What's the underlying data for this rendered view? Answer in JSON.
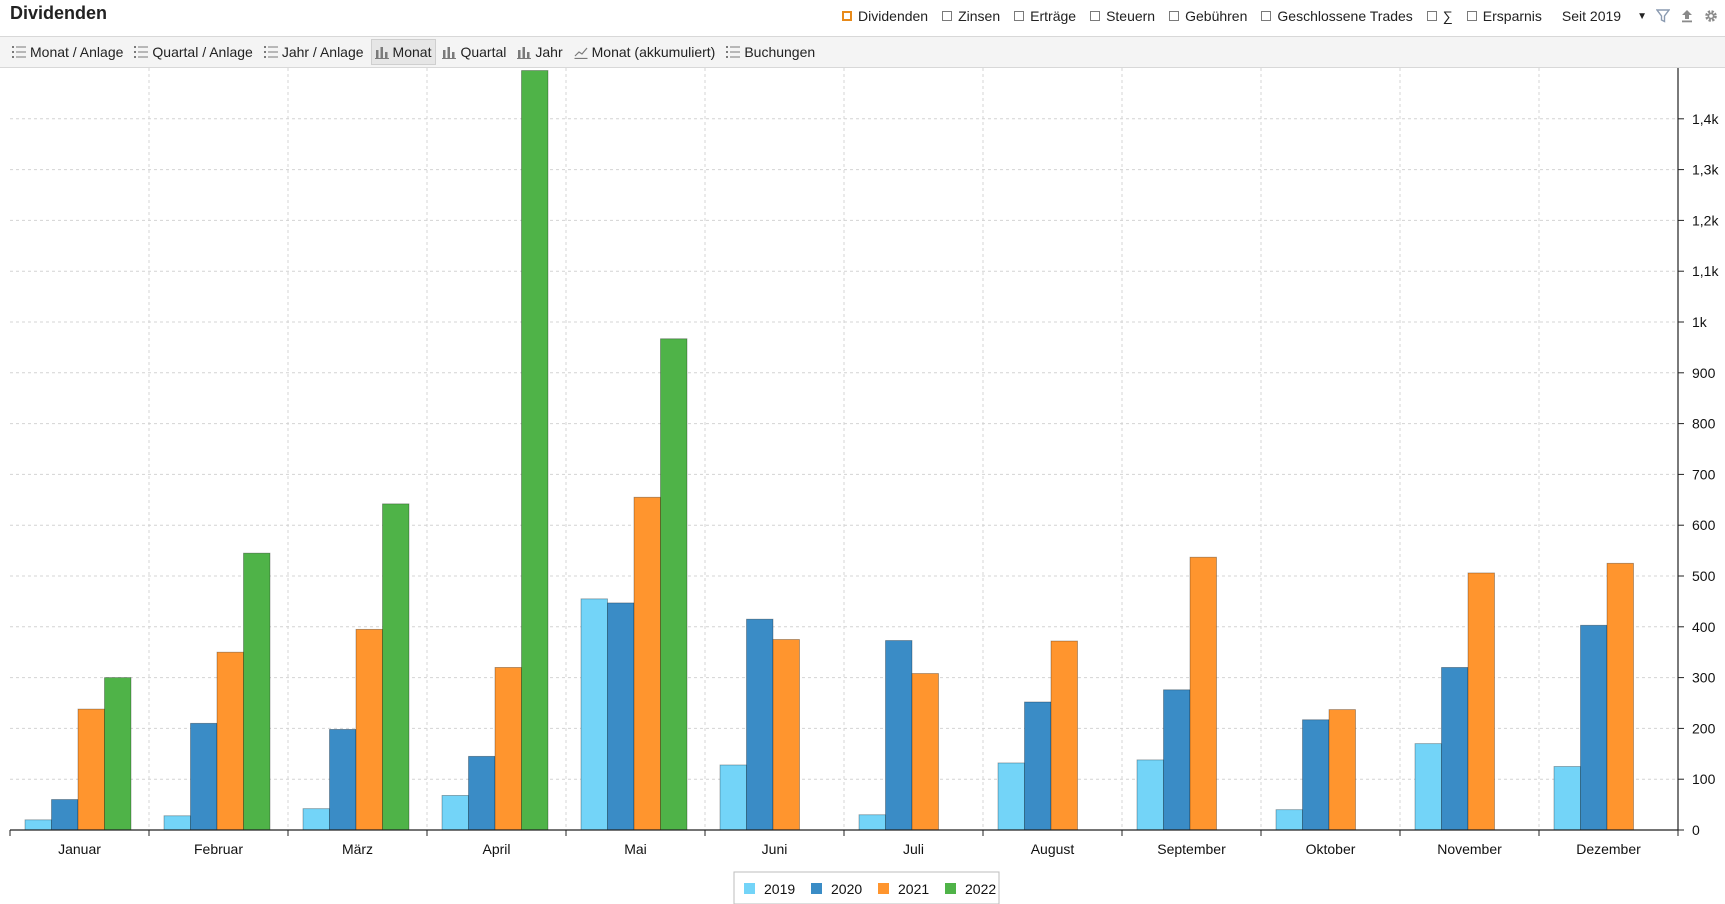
{
  "header": {
    "title": "Dividenden",
    "filters": [
      {
        "label": "Dividenden",
        "checked": true
      },
      {
        "label": "Zinsen",
        "checked": false
      },
      {
        "label": "Erträge",
        "checked": false
      },
      {
        "label": "Steuern",
        "checked": false
      },
      {
        "label": "Gebühren",
        "checked": false
      },
      {
        "label": "Geschlossene Trades",
        "checked": false
      },
      {
        "label": "∑",
        "checked": false
      },
      {
        "label": "Ersparnis",
        "checked": false
      }
    ],
    "period": "Seit 2019",
    "icons": [
      "filter-icon",
      "export-icon",
      "gear-icon"
    ]
  },
  "toolbar": {
    "items": [
      {
        "label": "Monat / Anlage",
        "icon": "list-icon",
        "active": false
      },
      {
        "label": "Quartal / Anlage",
        "icon": "list-icon",
        "active": false
      },
      {
        "label": "Jahr / Anlage",
        "icon": "list-icon",
        "active": false
      },
      {
        "label": "Monat",
        "icon": "bar-chart-icon",
        "active": true
      },
      {
        "label": "Quartal",
        "icon": "bar-chart-icon",
        "active": false
      },
      {
        "label": "Jahr",
        "icon": "bar-chart-icon",
        "active": false
      },
      {
        "label": "Monat (akkumuliert)",
        "icon": "line-chart-icon",
        "active": false
      },
      {
        "label": "Buchungen",
        "icon": "list-icon",
        "active": false
      }
    ]
  },
  "chart_data": {
    "type": "bar",
    "categories": [
      "Januar",
      "Februar",
      "März",
      "April",
      "Mai",
      "Juni",
      "Juli",
      "August",
      "September",
      "Oktober",
      "November",
      "Dezember"
    ],
    "series": [
      {
        "name": "2019",
        "color": "#73d4f8",
        "values": [
          20,
          28,
          42,
          68,
          455,
          128,
          30,
          132,
          138,
          40,
          170,
          125
        ]
      },
      {
        "name": "2020",
        "color": "#3a8cc6",
        "values": [
          60,
          210,
          198,
          145,
          447,
          415,
          373,
          252,
          276,
          217,
          320,
          403
        ]
      },
      {
        "name": "2021",
        "color": "#ff952e",
        "values": [
          238,
          350,
          395,
          320,
          655,
          375,
          308,
          372,
          537,
          237,
          506,
          525
        ]
      },
      {
        "name": "2022",
        "color": "#4fb348",
        "values": [
          300,
          545,
          642,
          1495,
          967,
          null,
          null,
          null,
          null,
          null,
          null,
          null
        ]
      }
    ],
    "ylim": [
      0,
      1500
    ],
    "y_ticks": [
      0,
      100,
      200,
      300,
      400,
      500,
      600,
      700,
      800,
      900,
      1000,
      1100,
      1200,
      1300,
      1400
    ],
    "y_tick_labels": [
      "0",
      "100",
      "200",
      "300",
      "400",
      "500",
      "600",
      "700",
      "800",
      "900",
      "1k",
      "1,1k",
      "1,2k",
      "1,3k",
      "1,4k"
    ],
    "y_axis_position": "right",
    "grid": true,
    "legend": "bottom-center",
    "title": "",
    "xlabel": "",
    "ylabel": ""
  }
}
